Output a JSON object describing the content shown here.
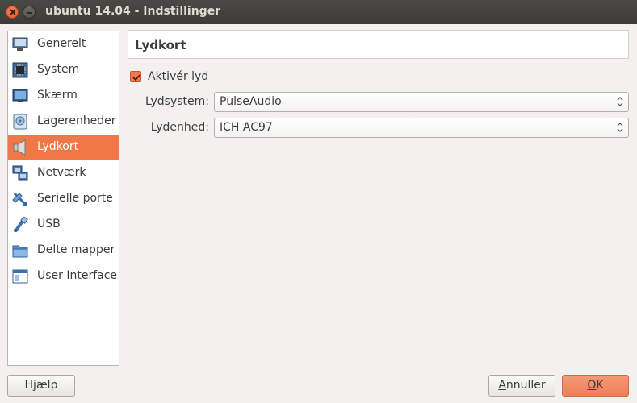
{
  "window": {
    "title": "ubuntu 14.04 - Indstillinger"
  },
  "sidebar": {
    "items": [
      {
        "label": "Generelt",
        "icon": "monitor-icon"
      },
      {
        "label": "System",
        "icon": "chip-icon"
      },
      {
        "label": "Skærm",
        "icon": "display-icon"
      },
      {
        "label": "Lagerenheder",
        "icon": "disk-icon"
      },
      {
        "label": "Lydkort",
        "icon": "speaker-icon",
        "active": true
      },
      {
        "label": "Netværk",
        "icon": "network-icon"
      },
      {
        "label": "Serielle porte",
        "icon": "serial-port-icon"
      },
      {
        "label": "USB",
        "icon": "usb-icon"
      },
      {
        "label": "Delte mapper",
        "icon": "folder-icon"
      },
      {
        "label": "User Interface",
        "icon": "window-icon"
      }
    ]
  },
  "section": {
    "title": "Lydkort"
  },
  "audio": {
    "enable_label_pre": "",
    "enable_label_mn": "A",
    "enable_label_post": "ktivér lyd",
    "enabled": true,
    "driver_label_pre": "Ly",
    "driver_label_mn": "d",
    "driver_label_post": "system:",
    "driver_value": "PulseAudio",
    "device_label": "Lydenhed:",
    "device_value": "ICH AC97"
  },
  "buttons": {
    "help_pre": "H",
    "help_mn": "j",
    "help_post": "ælp",
    "cancel_pre": "",
    "cancel_mn": "A",
    "cancel_post": "nnuller",
    "ok_pre": "",
    "ok_mn": "O",
    "ok_post": "K"
  },
  "colors": {
    "accent": "#f07746",
    "titlebar": "#3c3b37"
  }
}
